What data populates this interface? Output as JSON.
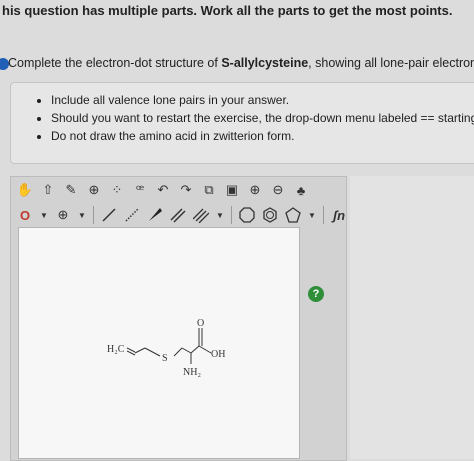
{
  "header": {
    "text": "his question has multiple parts. Work all the parts to get the most points."
  },
  "prompt": {
    "before": "Complete the electron-dot structure of ",
    "compound": "S-allylcysteine",
    "after": ", showing all lone-pair electrons."
  },
  "hints": [
    "Include all valence lone pairs in your answer.",
    "Should you want to restart the exercise, the drop-down menu labeled == starting",
    "Do not draw the amino acid in zwitterion form."
  ],
  "toolbar": {
    "row1_icons": [
      "hand-icon",
      "select-icon",
      "eraser-icon",
      "ring-charge-icon",
      "lone-pair-icon",
      "radical-icon",
      "undo-icon",
      "redo-icon",
      "copy-icon",
      "paste-icon",
      "zoom-in-icon",
      "zoom-out-icon",
      "color-icon"
    ],
    "row2": {
      "charge_minus": "O",
      "charge_plus": "⊕",
      "fn_label": "ʃn",
      "bracket_label": "[ ]±"
    }
  },
  "help": {
    "label": "?"
  },
  "molecule": {
    "h2c": "H₂C",
    "s": "S",
    "o": "O",
    "oh": "OH",
    "nh2": "NH₂"
  }
}
